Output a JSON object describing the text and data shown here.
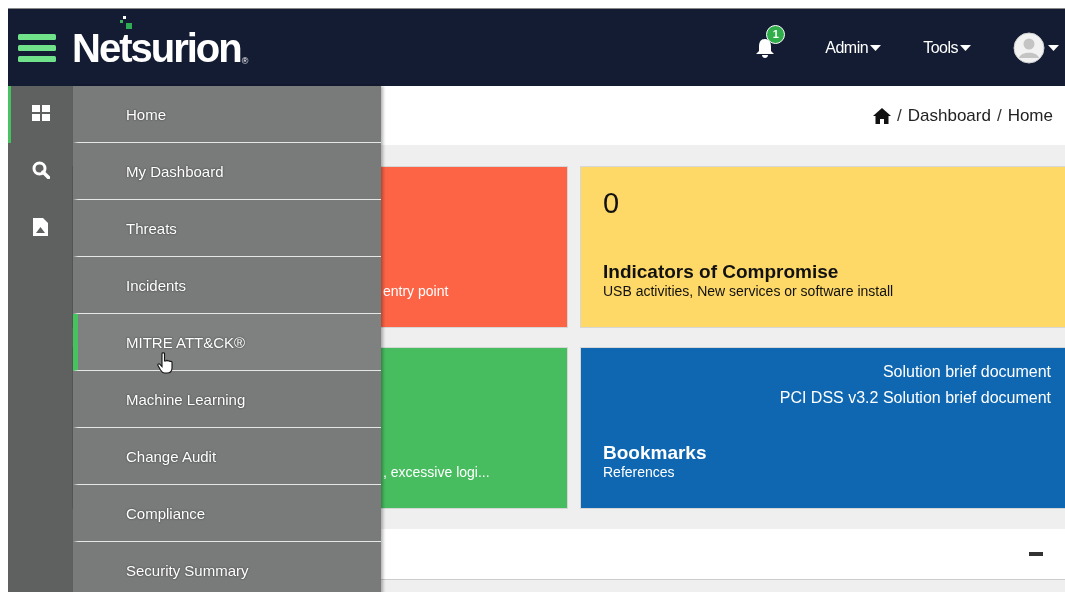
{
  "header": {
    "logo": "Netsurion",
    "logo_mark": "®",
    "notifications": {
      "count": "1"
    },
    "menus": [
      {
        "label": "Admin"
      },
      {
        "label": "Tools"
      }
    ]
  },
  "rail": [
    {
      "kind": "dashboard",
      "selected": true
    },
    {
      "kind": "search",
      "selected": false
    },
    {
      "kind": "report",
      "selected": false
    }
  ],
  "menu": [
    {
      "label": "Home",
      "selected": false
    },
    {
      "label": "My Dashboard",
      "selected": false
    },
    {
      "label": "Threats",
      "selected": false
    },
    {
      "label": "Incidents",
      "selected": false
    },
    {
      "label": "MITRE ATT&CK®",
      "selected": true
    },
    {
      "label": "Machine Learning",
      "selected": false
    },
    {
      "label": "Change Audit",
      "selected": false
    },
    {
      "label": "Compliance",
      "selected": false
    },
    {
      "label": "Security Summary",
      "selected": false
    }
  ],
  "breadcrumb": [
    {
      "separator": "/",
      "label": "Dashboard"
    },
    {
      "separator": "/",
      "label": "Home"
    }
  ],
  "tiles": [
    {
      "color": "#fd6446",
      "subtitle": "entry point"
    },
    {
      "color": "#fed967",
      "value": "0",
      "title": "Indicators of Compromise",
      "subtitle": "USB activities, New services or software install"
    },
    {
      "color": "#48bd60",
      "subtitle": ", excessive logi..."
    },
    {
      "color": "#0f67b1",
      "links": [
        "Solution brief document",
        "PCI DSS v3.2 Solution brief document"
      ],
      "title": "Bookmarks",
      "subtitle": "References"
    }
  ]
}
